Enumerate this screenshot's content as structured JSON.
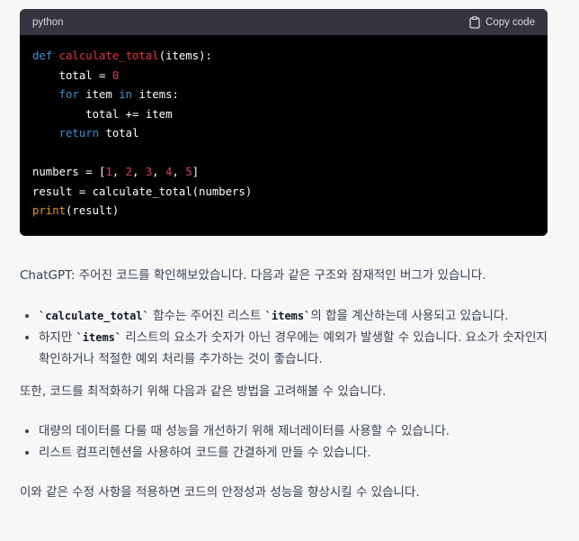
{
  "code_block": {
    "language": "python",
    "copy_label": "Copy code",
    "copy_icon": "clipboard-icon",
    "lines": [
      [
        {
          "t": "def ",
          "c": "kw"
        },
        {
          "t": "calculate_total",
          "c": "fn"
        },
        {
          "t": "(items):",
          "c": ""
        }
      ],
      [
        {
          "t": "    total = ",
          "c": ""
        },
        {
          "t": "0",
          "c": "num"
        }
      ],
      [
        {
          "t": "    ",
          "c": ""
        },
        {
          "t": "for",
          "c": "kw"
        },
        {
          "t": " item ",
          "c": ""
        },
        {
          "t": "in",
          "c": "kw"
        },
        {
          "t": " items:",
          "c": ""
        }
      ],
      [
        {
          "t": "        total += item",
          "c": ""
        }
      ],
      [
        {
          "t": "    ",
          "c": ""
        },
        {
          "t": "return",
          "c": "kw"
        },
        {
          "t": " total",
          "c": ""
        }
      ],
      [],
      [
        {
          "t": "numbers = [",
          "c": ""
        },
        {
          "t": "1",
          "c": "num"
        },
        {
          "t": ", ",
          "c": ""
        },
        {
          "t": "2",
          "c": "num"
        },
        {
          "t": ", ",
          "c": ""
        },
        {
          "t": "3",
          "c": "num"
        },
        {
          "t": ", ",
          "c": ""
        },
        {
          "t": "4",
          "c": "num"
        },
        {
          "t": ", ",
          "c": ""
        },
        {
          "t": "5",
          "c": "num"
        },
        {
          "t": "]",
          "c": ""
        }
      ],
      [
        {
          "t": "result = calculate_total(numbers)",
          "c": ""
        }
      ],
      [
        {
          "t": "print",
          "c": "bi"
        },
        {
          "t": "(result)",
          "c": ""
        }
      ]
    ]
  },
  "answer": {
    "intro": "ChatGPT: 주어진 코드를 확인해보았습니다. 다음과 같은 구조와 잠재적인 버그가 있습니다.",
    "bugs": [
      {
        "code1": "`calculate_total`",
        "text1": " 함수는 주어진 리스트 ",
        "code2": "`items`",
        "text2": "의 합을 계산하는데 사용되고 있습니다."
      },
      {
        "text0": "하지만 ",
        "code1": "`items`",
        "text1": " 리스트의 요소가 숫자가 아닌 경우에는 예외가 발생할 수 있습니다. 요소가 숫자인지 확인하거나 적절한 예외 처리를 추가하는 것이 좋습니다."
      }
    ],
    "optimize_intro": "또한, 코드를 최적화하기 위해 다음과 같은 방법을 고려해볼 수 있습니다.",
    "optimizations": [
      "대량의 데이터를 다룰 때 성능을 개선하기 위해 제너레이터를 사용할 수 있습니다.",
      "리스트 컴프리헨션을 사용하여 코드를 간결하게 만들 수 있습니다."
    ],
    "conclusion": "이와 같은 수정 사항을 적용하면 코드의 안정성과 성능을 향상시킬 수 있습니다."
  }
}
